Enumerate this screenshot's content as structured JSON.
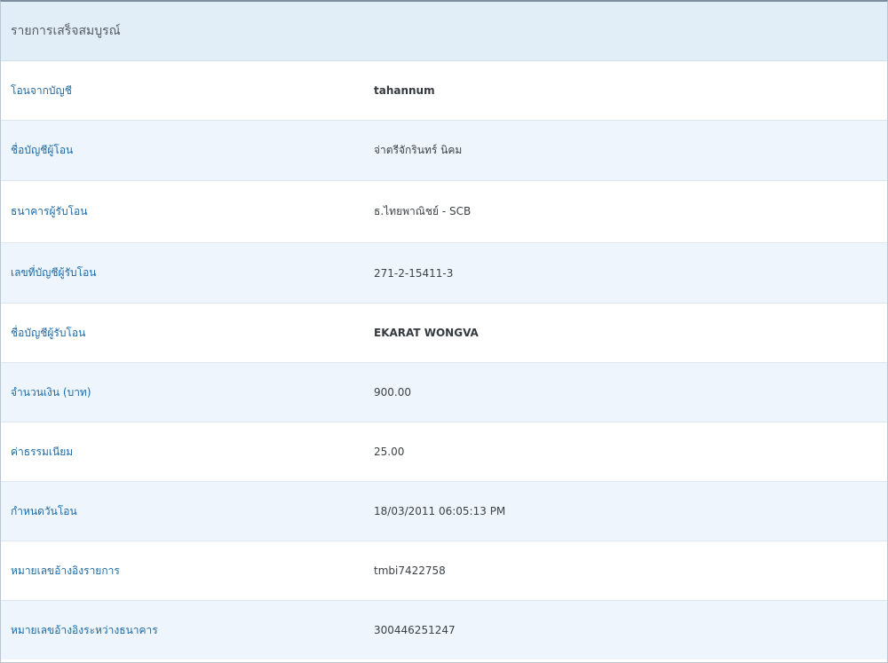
{
  "header": {
    "title": "รายการเสร็จสมบูรณ์"
  },
  "rows": [
    {
      "label": "โอนจากบัญชี",
      "value": "tahannum"
    },
    {
      "label": "ชื่อบัญชีผู้โอน",
      "value": "จ่าตรีจักรินทร์ นิคม"
    },
    {
      "label": "ธนาคารผู้รับโอน",
      "value": "ธ.ไทยพาณิชย์ - SCB"
    },
    {
      "label": "เลขที่บัญชีผู้รับโอน",
      "value": "271-2-15411-3"
    },
    {
      "label": "ชื่อบัญชีผู้รับโอน",
      "value": "EKARAT WONGVA"
    },
    {
      "label": "จำนวนเงิน (บาท)",
      "value": "900.00"
    },
    {
      "label": "ค่าธรรมเนียม",
      "value": "25.00"
    },
    {
      "label": "กำหนดวันโอน",
      "value": "18/03/2011 06:05:13 PM"
    },
    {
      "label": "หมายเลขอ้างอิงรายการ",
      "value": "tmbi7422758"
    },
    {
      "label": "หมายเลขอ้างอิงระหว่างธนาคาร",
      "value": "300446251247"
    }
  ],
  "colors": {
    "header_bg": "#e2eef7",
    "alt_row_bg": "#eef5fc",
    "label_color": "#1e6aa6",
    "value_color": "#3d4247"
  }
}
